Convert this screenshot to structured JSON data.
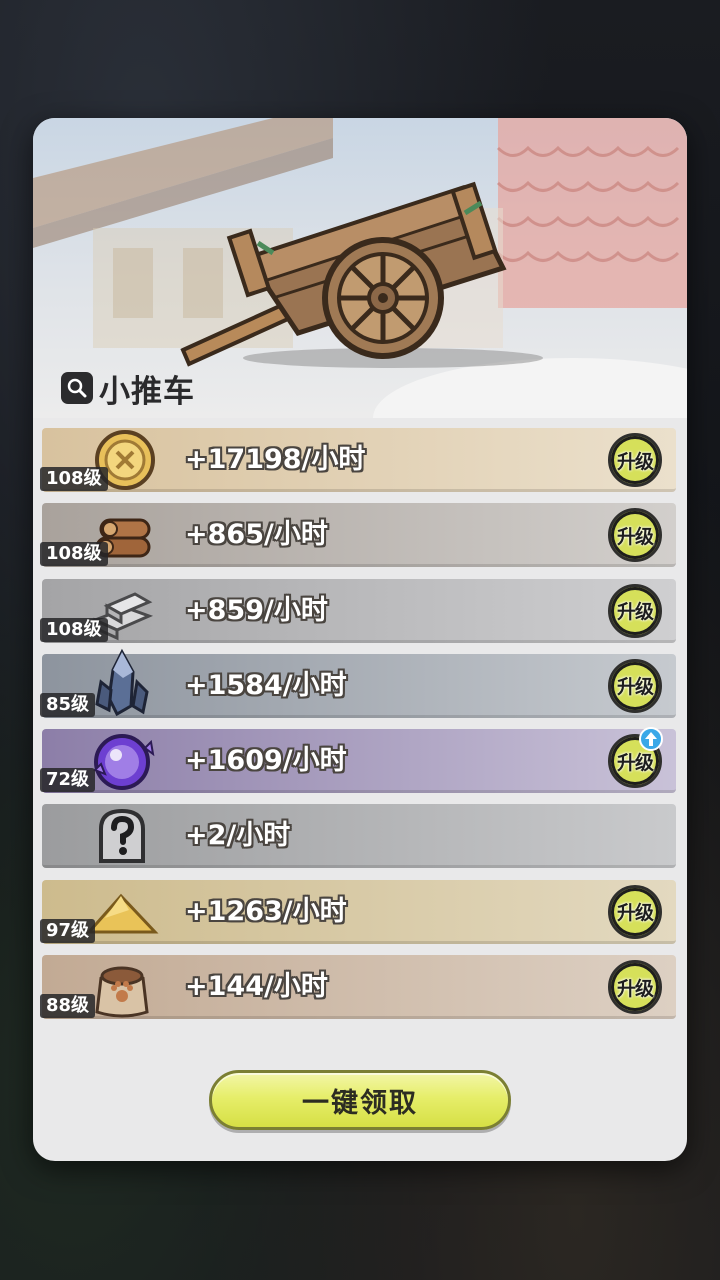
{
  "building": {
    "title": "小推车"
  },
  "resources": [
    {
      "level": "108级",
      "rate": "+17198/小时",
      "upgrade_label": "升级",
      "icon": "gold-coin-icon",
      "bg": "#d8c29e",
      "bg2": "#ebe0cc",
      "has_upgrade": true,
      "notify": false
    },
    {
      "level": "108级",
      "rate": "+865/小时",
      "upgrade_label": "升级",
      "icon": "wood-logs-icon",
      "bg": "#a9a29c",
      "bg2": "#d2cfcc",
      "has_upgrade": true,
      "notify": false
    },
    {
      "level": "108级",
      "rate": "+859/小时",
      "upgrade_label": "升级",
      "icon": "stone-bricks-icon",
      "bg": "#a4a4a6",
      "bg2": "#cfcfd1",
      "has_upgrade": true,
      "notify": false
    },
    {
      "level": "85级",
      "rate": "+1584/小时",
      "upgrade_label": "升级",
      "icon": "crystal-ore-icon",
      "bg": "#8d949e",
      "bg2": "#c6cacf",
      "has_upgrade": true,
      "notify": false
    },
    {
      "level": "72级",
      "rate": "+1609/小时",
      "upgrade_label": "升级",
      "icon": "magic-orb-icon",
      "bg": "#8c7ea8",
      "bg2": "#c9c2d8",
      "has_upgrade": true,
      "notify": true
    },
    {
      "level": "",
      "rate": "+2/小时",
      "upgrade_label": "",
      "icon": "mystery-item-icon",
      "bg": "#9b9c9e",
      "bg2": "#c9cacc",
      "has_upgrade": false,
      "notify": false
    },
    {
      "level": "97级",
      "rate": "+1263/小时",
      "upgrade_label": "升级",
      "icon": "sand-pile-icon",
      "bg": "#cdbb8d",
      "bg2": "#e3d9c0",
      "has_upgrade": true,
      "notify": false
    },
    {
      "level": "88级",
      "rate": "+144/小时",
      "upgrade_label": "升级",
      "icon": "food-sack-icon",
      "bg": "#c2aa94",
      "bg2": "#ddd0c3",
      "has_upgrade": true,
      "notify": false
    }
  ],
  "claim_all": {
    "label": "一键领取"
  }
}
